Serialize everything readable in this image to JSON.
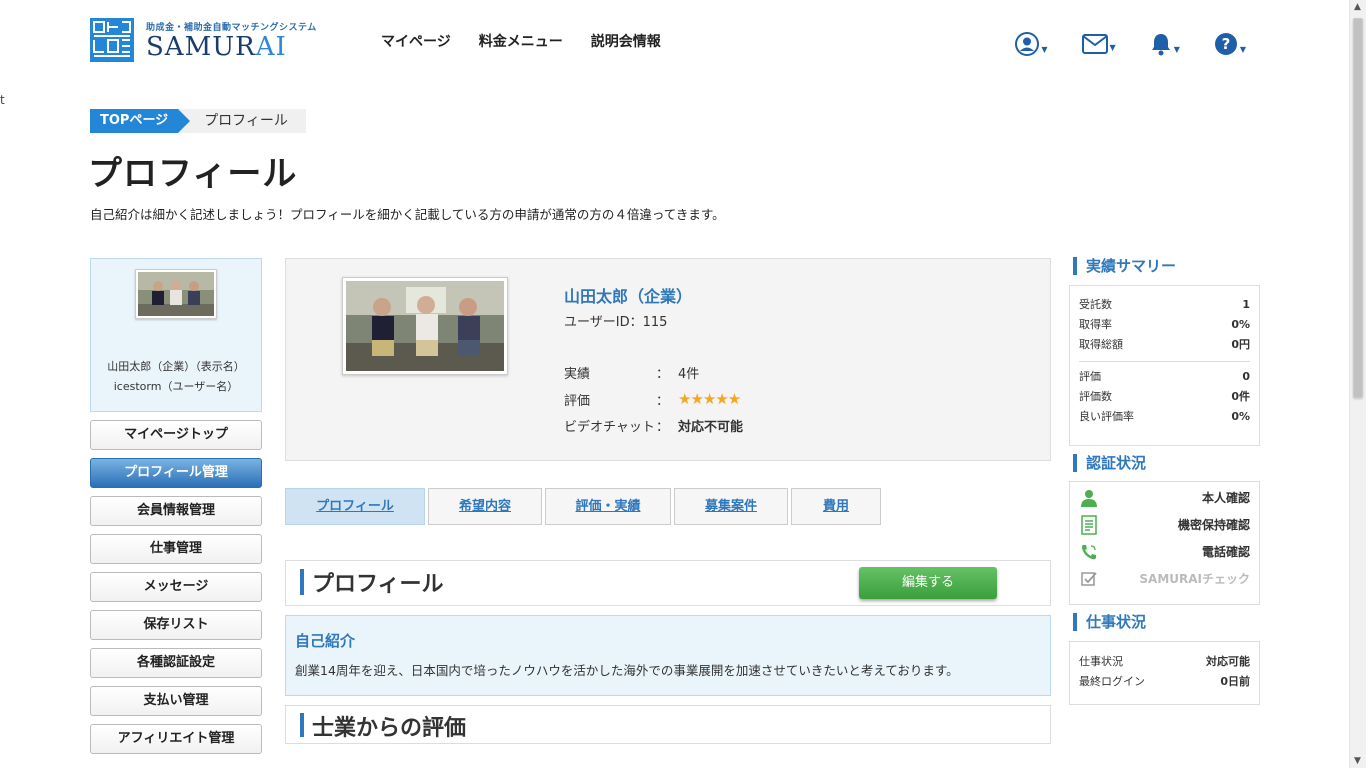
{
  "header": {
    "logo_sub": "助成金・補助金自動マッチングシステム",
    "logo_main_a": "SAMUR",
    "logo_main_b": "AI",
    "nav": [
      "マイページ",
      "料金メニュー",
      "説明会情報"
    ]
  },
  "stray_text": "t",
  "breadcrumb": {
    "top": "TOPページ",
    "current": "プロフィール"
  },
  "page_title": "プロフィール",
  "lead": "自己紹介は細かく記述しましょう！プロフィールを細かく記載している方の申請が通常の方の４倍違ってきます。",
  "sidebar": {
    "display_name": "山田太郎（企業）（表示名）",
    "user_name": "icestorm（ユーザー名）",
    "menu": [
      "マイページトップ",
      "プロフィール管理",
      "会員情報管理",
      "仕事管理",
      "メッセージ",
      "保存リスト",
      "各種認証設定",
      "支払い管理",
      "アフィリエイト管理"
    ],
    "active_index": 1
  },
  "profile": {
    "name": "山田太郎（企業）",
    "user_id": "ユーザーID：115",
    "stats": [
      {
        "label": "実績",
        "sep": "：",
        "value": "4件"
      },
      {
        "label": "評価",
        "sep": "：",
        "value": "★★★★★"
      },
      {
        "label": "ビデオチャット",
        "sep": "：",
        "value": "対応不可能"
      }
    ],
    "rating_stars": 5
  },
  "tabs": [
    "プロフィール",
    "希望内容",
    "評価・実績",
    "募集案件",
    "費用"
  ],
  "section_profile": {
    "title": "プロフィール",
    "edit_label": "編集する"
  },
  "intro": {
    "heading": "自己紹介",
    "body": "創業14周年を迎え、日本国内で培ったノウハウを活かした海外での事業展開を加速させていきたいと考えております。"
  },
  "section_review": {
    "title": "士業からの評価"
  },
  "summary": {
    "title": "実績サマリー",
    "rows1": [
      {
        "label": "受託数",
        "value": "1"
      },
      {
        "label": "取得率",
        "value": "0%"
      },
      {
        "label": "取得総額",
        "value": "0円"
      }
    ],
    "rows2": [
      {
        "label": "評価",
        "value": "0"
      },
      {
        "label": "評価数",
        "value": "0件"
      },
      {
        "label": "良い評価率",
        "value": "0%"
      }
    ]
  },
  "certification": {
    "title": "認証状況",
    "items": [
      {
        "label": "本人確認",
        "icon": "person-icon",
        "enabled": true
      },
      {
        "label": "機密保持確認",
        "icon": "document-icon",
        "enabled": true
      },
      {
        "label": "電話確認",
        "icon": "phone-icon",
        "enabled": true
      },
      {
        "label": "SAMURAIチェック",
        "icon": "checkbox-icon",
        "enabled": false
      }
    ]
  },
  "work_status": {
    "title": "仕事状況",
    "rows": [
      {
        "label": "仕事状況",
        "value": "対応可能"
      },
      {
        "label": "最終ログイン",
        "value": "0日前"
      }
    ]
  },
  "colors": {
    "accent": "#2f78bc",
    "green": "#4caf50",
    "star": "#f5a623"
  }
}
